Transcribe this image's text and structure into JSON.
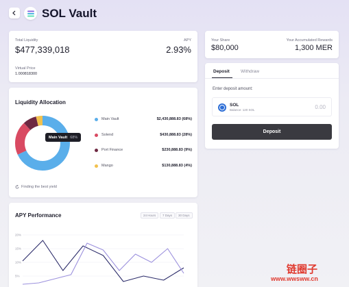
{
  "header": {
    "title": "SOL Vault"
  },
  "liquidity": {
    "total_label": "Total Liquidity",
    "total_value": "$477,339,018",
    "apy_label": "APY",
    "apy_value": "2.93%",
    "vprice_label": "Virtual Price",
    "vprice_value": "1.000818300"
  },
  "allocation": {
    "title": "Liquidity Allocation",
    "tooltip_name": "Main Vault",
    "tooltip_pct": "68%",
    "footer": "Finding the best yield",
    "items": [
      {
        "name": "Main Vault",
        "value": "$2,430,888.83 (68%)",
        "color": "#5aaeea",
        "share": 68
      },
      {
        "name": "Solend",
        "value": "$430,888.83 (28%)",
        "color": "#d94a62",
        "share": 20
      },
      {
        "name": "Port Finance",
        "value": "$230,888.83 (9%)",
        "color": "#6e2841",
        "share": 8
      },
      {
        "name": "Mango",
        "value": "$130,888.83 (4%)",
        "color": "#f2c14e",
        "share": 4
      }
    ]
  },
  "apy_chart": {
    "title": "APY Performance",
    "ranges": [
      "24 Hours",
      "7 Days",
      "30 Days"
    ],
    "y_ticks": [
      "20%",
      "15%",
      "10%",
      "5%"
    ]
  },
  "chart_data": {
    "type": "line",
    "title": "APY Performance",
    "xlabel": "",
    "ylabel": "",
    "ylim": [
      2,
      22
    ],
    "series": [
      {
        "values": [
          10.5,
          18,
          7,
          16,
          12.5,
          3,
          5,
          3.5,
          8
        ]
      },
      {
        "values": [
          2,
          2.5,
          4,
          5.5,
          17,
          14.5,
          7,
          13,
          10,
          15,
          6
        ]
      }
    ],
    "colors": [
      "#2c2c6a",
      "#9b90dd"
    ]
  },
  "share": {
    "share_label": "Your Share",
    "share_value": "$80,000",
    "rewards_label": "Your Accumulated Rewards",
    "rewards_value": "1,300 MER"
  },
  "deposit": {
    "tab_deposit": "Deposit",
    "tab_withdraw": "Withdraw",
    "enter_label": "Enter deposit amount:",
    "token": "SOL",
    "balance": "Balance: 120 SOL",
    "amount": "0.00",
    "button": "Deposit"
  },
  "watermark": {
    "line1": "链圈子",
    "line2": "www.wwsww.cn"
  }
}
